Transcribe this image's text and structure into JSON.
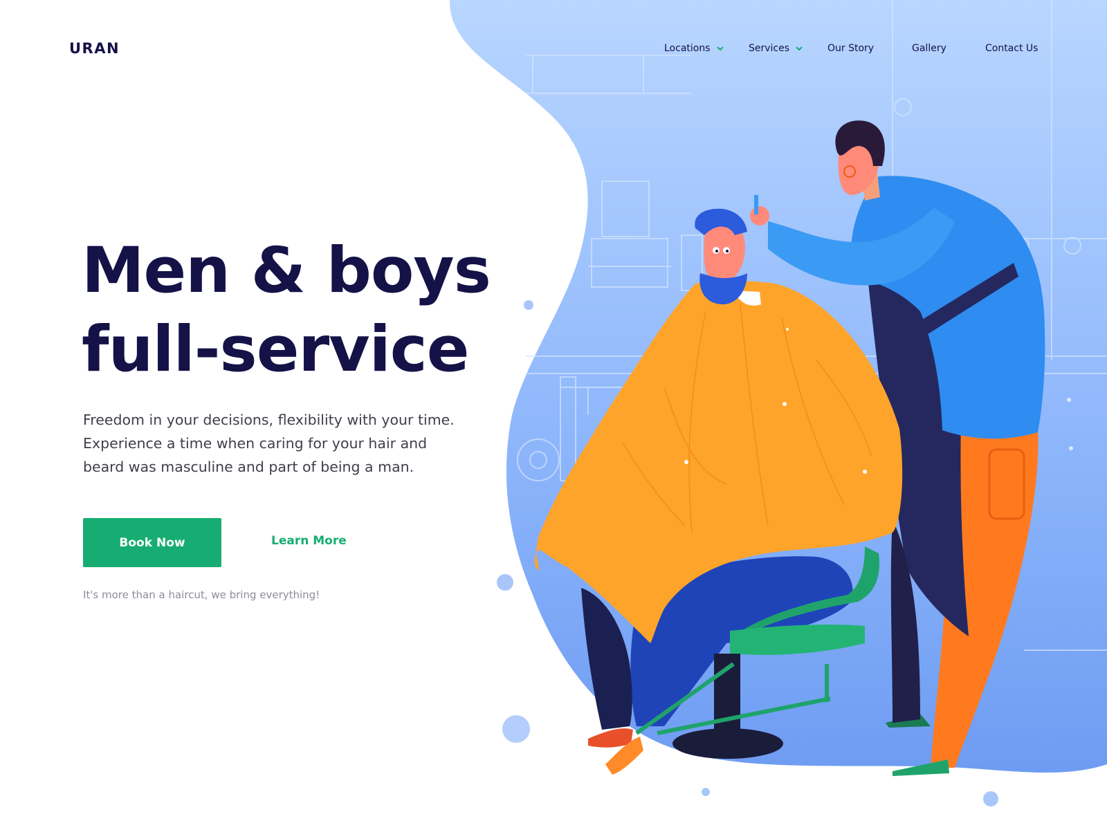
{
  "brand": {
    "logo": "URAN"
  },
  "nav": {
    "items": [
      {
        "label": "Locations",
        "has_dropdown": true
      },
      {
        "label": "Services",
        "has_dropdown": true
      },
      {
        "label": "Our Story",
        "has_dropdown": false
      },
      {
        "label": "Gallery",
        "has_dropdown": false
      },
      {
        "label": "Contact Us",
        "has_dropdown": false
      }
    ],
    "dropdown_icon": "chevron-down-icon"
  },
  "hero": {
    "title_line1": "Men & boys",
    "title_line2": "full-service",
    "description_lines": [
      "Freedom in your decisions, flexibility with your time.",
      "Experience a time when caring for your hair and",
      "beard was masculine and part of being a man."
    ],
    "primary_button": "Book Now",
    "secondary_link": "Learn More",
    "tagline": "It's more than a haircut, we bring everything!"
  },
  "colors": {
    "heading": "#151248",
    "accent_green": "#17ad72",
    "blob_blue": "#9cc2ff",
    "cape_orange": "#ffa42b",
    "jacket_blue": "#2f8cf0",
    "trousers_blue": "#1f44b8",
    "chair_green": "#1fa36b",
    "pants_orange": "#ff7a1f"
  },
  "illustration": {
    "subject": "barber-cutting-hair-illustration"
  }
}
